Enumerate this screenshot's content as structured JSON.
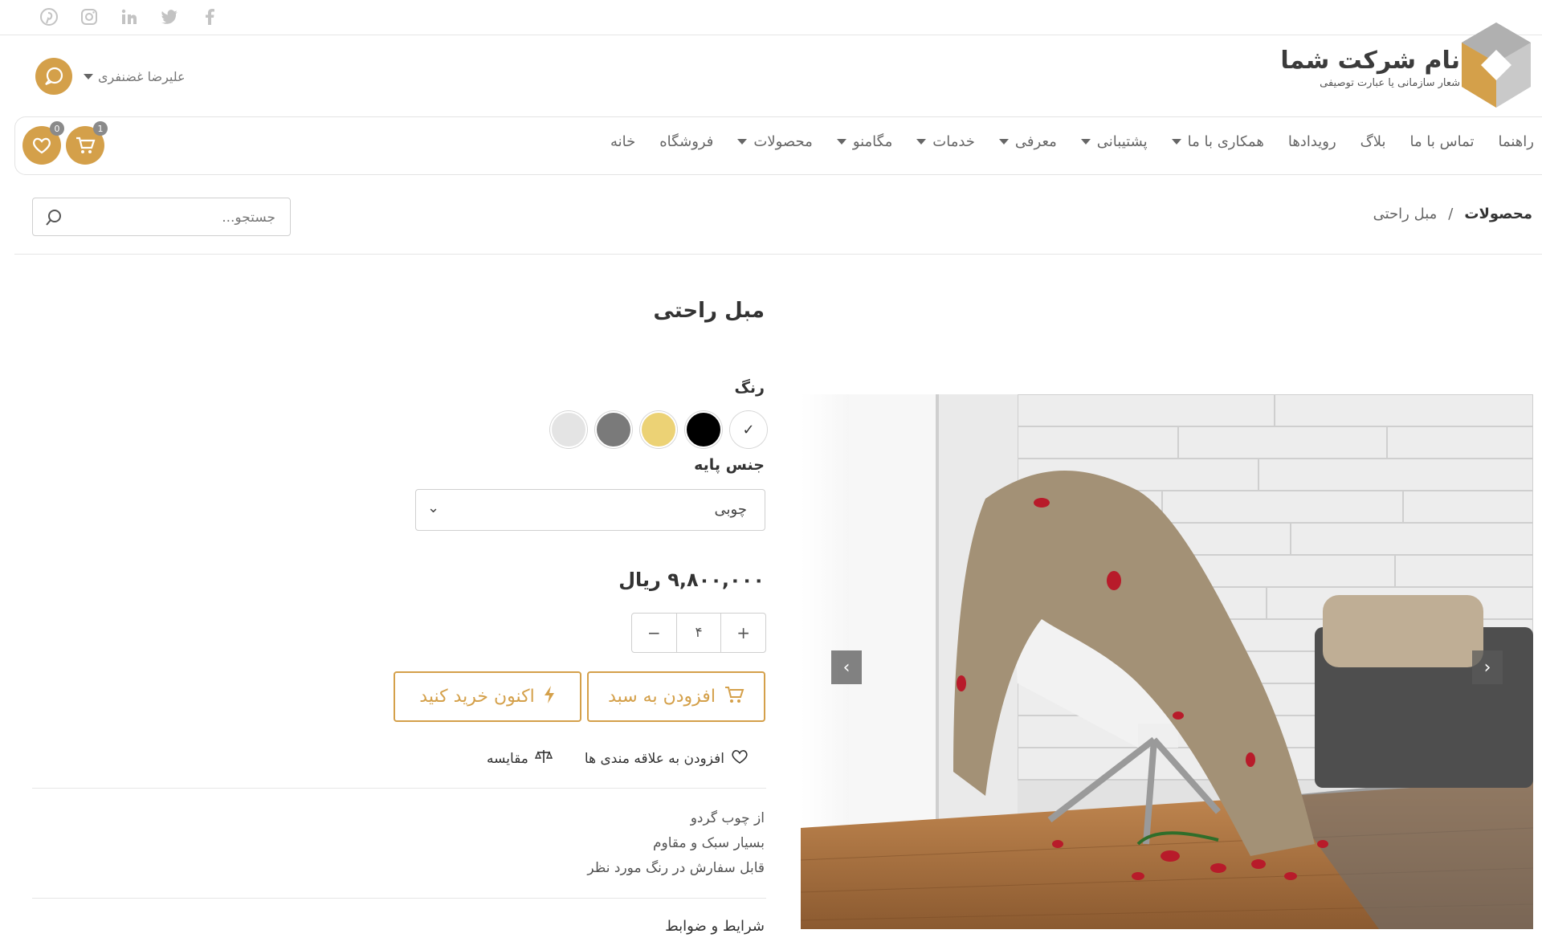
{
  "social": {
    "icons": [
      "pinterest-icon",
      "instagram-icon",
      "linkedin-icon",
      "twitter-icon",
      "facebook-icon"
    ]
  },
  "brand": {
    "title": "نام شرکت شما",
    "subtitle": "شعار سازمانی یا عبارت توصیفی"
  },
  "user": {
    "name": "علیرضا غضنفری"
  },
  "nav": {
    "items": [
      {
        "label": "خانه",
        "dropdown": false
      },
      {
        "label": "فروشگاه",
        "dropdown": false
      },
      {
        "label": "محصولات",
        "dropdown": true
      },
      {
        "label": "مگامنو",
        "dropdown": true
      },
      {
        "label": "خدمات",
        "dropdown": true
      },
      {
        "label": "معرفی",
        "dropdown": true
      },
      {
        "label": "پشتیبانی",
        "dropdown": true
      },
      {
        "label": "همکاری با ما",
        "dropdown": true
      },
      {
        "label": "رویدادها",
        "dropdown": false
      },
      {
        "label": "بلاگ",
        "dropdown": false
      },
      {
        "label": "تماس با ما",
        "dropdown": false
      },
      {
        "label": "راهنما",
        "dropdown": false
      }
    ],
    "cart_count": "1",
    "wishlist_count": "0"
  },
  "breadcrumb": {
    "home": "محصولات",
    "separator": "/",
    "current": "مبل راحتی"
  },
  "search": {
    "placeholder": "جستجو..."
  },
  "product": {
    "title": "مبل راحتی",
    "color_label": "رنگ",
    "colors": [
      "#ffffff",
      "#000000",
      "#ecd275",
      "#7a7a7a",
      "#e4e4e4"
    ],
    "selected_color_mark": "✓",
    "base_label": "جنس پایه",
    "base_value": "چوبی",
    "price": "۹,۸۰۰,۰۰۰ ریال",
    "qty": {
      "minus": "−",
      "value": "۴",
      "plus": "+"
    },
    "add_to_cart": "افزودن به سبد",
    "buy_now": "اکنون خرید کنید",
    "compare": "مقایسه",
    "wishlist": "افزودن به علاقه مندی ها",
    "description": [
      "از چوب گردو",
      "بسیار سبک و مقاوم",
      "قابل سفارش در رنگ مورد نظر"
    ],
    "terms": "شرایط و ضوابط"
  },
  "colors": {
    "accent": "#d4a04a"
  }
}
